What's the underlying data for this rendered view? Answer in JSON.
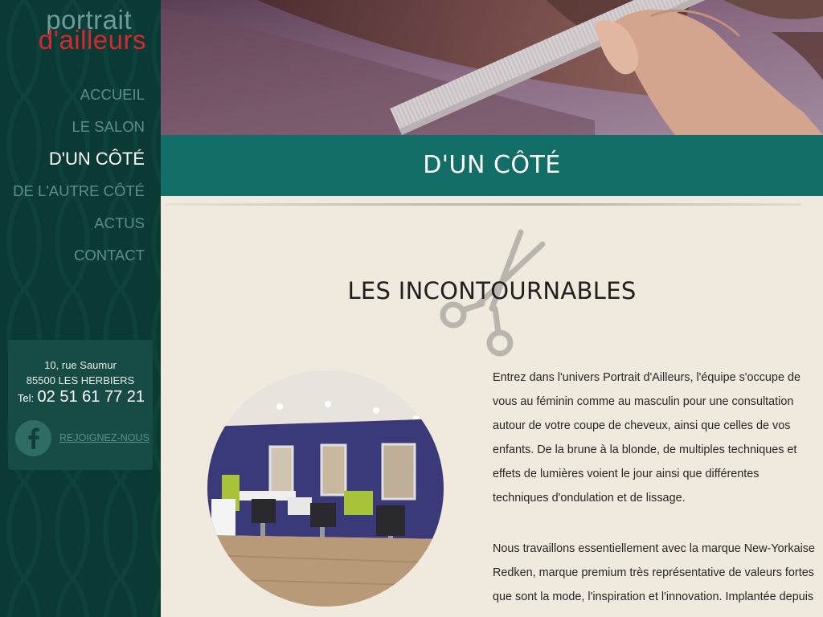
{
  "brand": {
    "logo_top": "portrait",
    "logo_bottom": "d'ailleurs",
    "colors": {
      "sidebar": "#0a3a33",
      "accent": "#136e67",
      "logo_red": "#d9272f",
      "page_bg": "#f0e9de"
    }
  },
  "nav": {
    "items": [
      {
        "label": "ACCUEIL"
      },
      {
        "label": "LE SALON"
      },
      {
        "label": "D'UN CÔTÉ",
        "active": true
      },
      {
        "label": "DE L'AUTRE CÔTÉ"
      },
      {
        "label": "ACTUS"
      },
      {
        "label": "CONTACT"
      }
    ]
  },
  "contact": {
    "address_line1": "10, rue Saumur",
    "address_line2": "85500 LES HERBIERS",
    "tel_label": "Tel:",
    "tel_number": "02 51 61 77 21",
    "facebook_icon": "facebook-icon",
    "facebook_link": "REJOIGNEZ-NOUS"
  },
  "page": {
    "title": "D'UN CÔTÉ",
    "section_title": "LES INCONTOURNABLES",
    "paragraph1": "Entrez dans l'univers Portrait d'Ailleurs, l'équipe s'occupe de vous au féminin comme au masculin pour une consultation autour de votre coupe de cheveux, ainsi que celles de vos enfants. De la brune à la blonde, de multiples techniques et effets de lumières voient le jour ainsi que différentes techniques d'ondulation et de lissage.",
    "paragraph2": "Nous travaillons essentiellement avec la marque New-Yorkaise Redken, marque premium très représentative de valeurs fortes que sont la mode, l'inspiration et l'innovation. Implantée depuis"
  }
}
